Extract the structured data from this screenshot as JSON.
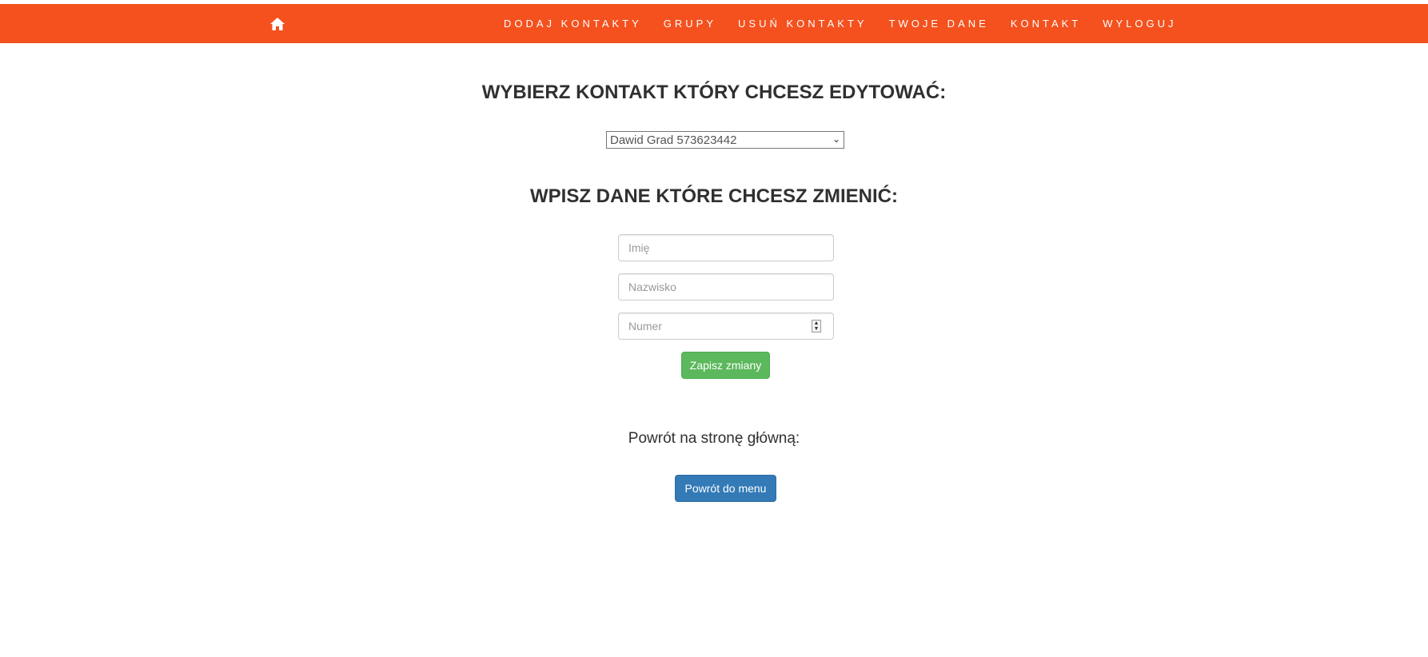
{
  "nav": {
    "home_icon": "home-icon",
    "items": [
      "Dodaj kontakty",
      "Grupy",
      "Usuń kontakty",
      "Twoje dane",
      "Kontakt",
      "Wyloguj"
    ]
  },
  "main": {
    "select_title": "WYBIERZ KONTAKT KTÓRY CHCESZ EDYTOWAĆ:",
    "selected_contact": "Dawid Grad 573623442",
    "edit_title": "WPISZ DANE KTÓRE CHCESZ ZMIENIĆ:",
    "fields": {
      "first_name_placeholder": "Imię",
      "last_name_placeholder": "Nazwisko",
      "number_placeholder": "Numer"
    },
    "save_button": "Zapisz zmiany",
    "back_text": "Powrót na stronę główną:",
    "back_button": "Powrót do menu"
  },
  "colors": {
    "navbar": "#f4511e",
    "save_button": "#5cb85c",
    "back_button": "#337ab7"
  }
}
